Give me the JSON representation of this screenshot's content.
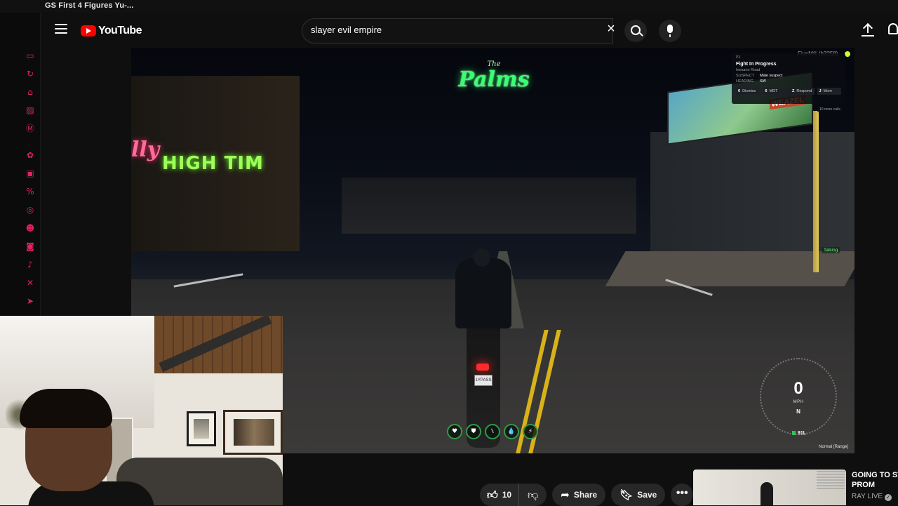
{
  "browser": {
    "tab_title": "GS First 4 Figures Yu-..."
  },
  "rail": {
    "icons": [
      "gamepad-icon",
      "refresh-icon",
      "car-icon",
      "card-icon",
      "m-badge-icon",
      "openai-icon",
      "twitch-icon",
      "percent-icon",
      "whatsapp-icon",
      "discord-icon",
      "instagram-icon",
      "tiktok-icon",
      "x-icon",
      "telegram-icon"
    ],
    "accent_color": "#e0245e"
  },
  "masthead": {
    "logo_text": "YouTube",
    "search_value": "slayer evil empire",
    "clear_symbol": "×"
  },
  "video": {
    "scene": {
      "logo_small": "The",
      "logo_main": "Palms",
      "sign_high": "HIGH TIM",
      "sign_pink": "lly",
      "billboard_text": "WEAZEL"
    },
    "hud": {
      "server": "FiveM® (b3258)",
      "dispatch": {
        "code": "P3",
        "title": "Fight In Progress",
        "location": "Inesano Road",
        "fields": [
          {
            "key": "SUSPECT",
            "value": "Male suspect"
          },
          {
            "key": "HEADING",
            "value": "SW"
          }
        ],
        "actions": [
          {
            "key": "0",
            "label": "Dismiss"
          },
          {
            "key": "6",
            "label": "MDT"
          },
          {
            "key": "Z",
            "label": "Respond"
          },
          {
            "key": "J",
            "label": "More"
          }
        ],
        "more_calls": "10 more calls"
      },
      "talking": "Talking",
      "status_icons": [
        "heart-icon",
        "shield-icon",
        "food-icon",
        "water-icon",
        "stamina-icon"
      ],
      "status_glyphs": [
        "♥",
        "⛊",
        "⑊",
        "💧",
        "⚡"
      ],
      "speed": "0",
      "speed_unit": "MPH",
      "gear": "N",
      "fuel": "91L",
      "voice_mode": "Normal [Range]",
      "plate": "1YPASS"
    }
  },
  "actions": {
    "like_count": "10",
    "share_label": "Share",
    "save_label": "Save",
    "more_symbol": "•••"
  },
  "up_next": {
    "title_line1": "GOING TO ST",
    "title_line2": "PROM",
    "channel": "RAY LIVE"
  }
}
